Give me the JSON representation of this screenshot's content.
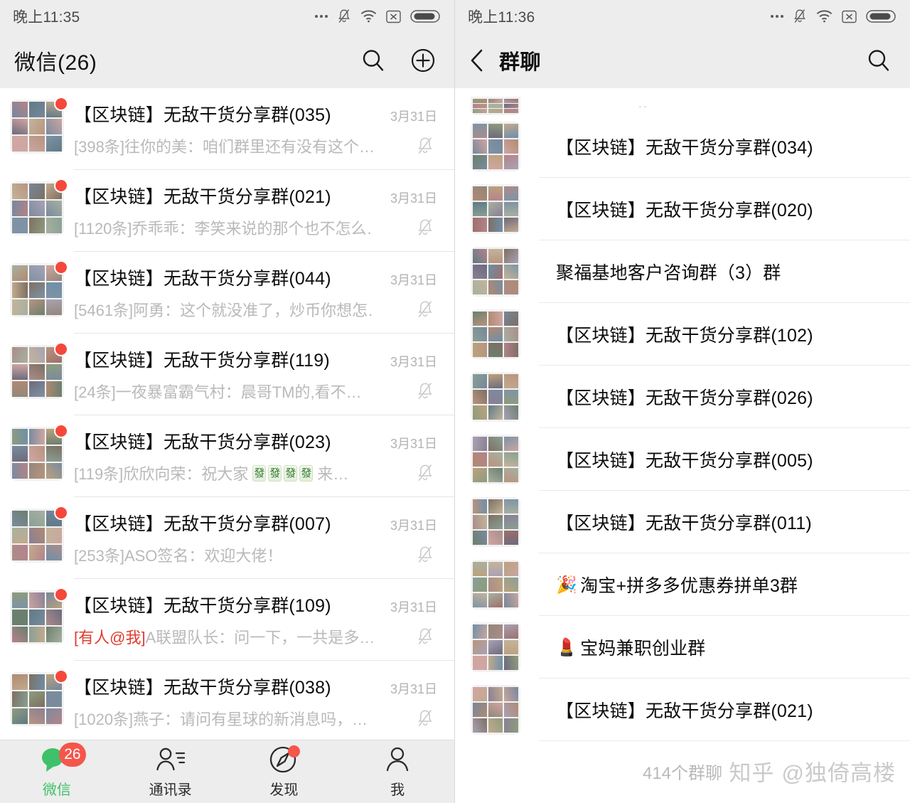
{
  "colors": {
    "accent_green": "#3ec16a",
    "badge_red": "#f5564a",
    "at_me_red": "#e03c30",
    "bar_bg": "#ededed",
    "muted_text": "#b9b9b9"
  },
  "left_panel": {
    "status_bar": {
      "time": "晚上11:35",
      "icons": [
        "more-dots-icon",
        "bell-muted-icon",
        "wifi-icon",
        "no-sim-icon",
        "battery-icon"
      ]
    },
    "nav": {
      "title": "微信(26)",
      "search_icon": "search-icon",
      "add_icon": "plus-circle-icon"
    },
    "chats": [
      {
        "title": "【区块链】无敌干货分享群(035)",
        "time": "3月31日",
        "snippet_prefix": "[398条]",
        "snippet": "往你的美：咱们群里还有没有这个…",
        "at_me": false,
        "muted": true,
        "unread_dot": true
      },
      {
        "title": "【区块链】无敌干货分享群(021)",
        "time": "3月31日",
        "snippet_prefix": "[1120条]",
        "snippet": "乔乖乖：李笑来说的那个也不怎么…",
        "at_me": false,
        "muted": true,
        "unread_dot": true
      },
      {
        "title": "【区块链】无敌干货分享群(044)",
        "time": "3月31日",
        "snippet_prefix": "[5461条]",
        "snippet": "阿勇：这个就没准了，炒币你想怎…",
        "at_me": false,
        "muted": true,
        "unread_dot": true
      },
      {
        "title": "【区块链】无敌干货分享群(119)",
        "time": "3月31日",
        "snippet_prefix": "[24条]",
        "snippet": "一夜暴富霸气村：晨哥TM的,看不…",
        "at_me": false,
        "muted": true,
        "unread_dot": true
      },
      {
        "title": "【区块链】无敌干货分享群(023)",
        "time": "3月31日",
        "snippet_prefix": "[119条]",
        "snippet": "欣欣向荣：祝大家",
        "snippet_tail": "来…",
        "mahjong_tiles": [
          "發",
          "發",
          "發",
          "發"
        ],
        "at_me": false,
        "muted": true,
        "unread_dot": true
      },
      {
        "title": "【区块链】无敌干货分享群(007)",
        "time": "3月31日",
        "snippet_prefix": "[253条]",
        "snippet": "ASO签名：欢迎大佬！",
        "at_me": false,
        "muted": true,
        "unread_dot": true
      },
      {
        "title": "【区块链】无敌干货分享群(109)",
        "time": "3月31日",
        "snippet_prefix": "[有人@我]",
        "snippet": "A联盟队长：问一下，一共是多…",
        "at_me": true,
        "muted": true,
        "unread_dot": true
      },
      {
        "title": "【区块链】无敌干货分享群(038)",
        "time": "3月31日",
        "snippet_prefix": "[1020条]",
        "snippet": "燕子：请问有星球的新消息吗，…",
        "at_me": false,
        "muted": true,
        "unread_dot": true
      }
    ],
    "tabs": [
      {
        "label": "微信",
        "icon": "chat-bubble-icon",
        "active": true,
        "badge_count": "26",
        "dot": false
      },
      {
        "label": "通讯录",
        "icon": "contacts-icon",
        "active": false,
        "badge_count": "",
        "dot": false
      },
      {
        "label": "发现",
        "icon": "compass-icon",
        "active": false,
        "badge_count": "",
        "dot": true
      },
      {
        "label": "我",
        "icon": "person-icon",
        "active": false,
        "badge_count": "",
        "dot": false
      }
    ]
  },
  "right_panel": {
    "status_bar": {
      "time": "晚上11:36",
      "icons": [
        "more-dots-icon",
        "bell-muted-icon",
        "wifi-icon",
        "no-sim-icon",
        "battery-icon"
      ]
    },
    "nav": {
      "back_icon": "back-chevron-icon",
      "title": "群聊",
      "search_icon": "search-icon"
    },
    "scroll_hint": "..",
    "groups": [
      {
        "name": "【区块链】无敌干货分享群(034)",
        "emoji": ""
      },
      {
        "name": "【区块链】无敌干货分享群(020)",
        "emoji": ""
      },
      {
        "name": "聚福基地客户咨询群（3）群",
        "emoji": ""
      },
      {
        "name": "【区块链】无敌干货分享群(102)",
        "emoji": ""
      },
      {
        "name": "【区块链】无敌干货分享群(026)",
        "emoji": ""
      },
      {
        "name": "【区块链】无敌干货分享群(005)",
        "emoji": ""
      },
      {
        "name": "【区块链】无敌干货分享群(011)",
        "emoji": ""
      },
      {
        "name": "淘宝+拼多多优惠券拼单3群",
        "emoji": "🎉"
      },
      {
        "name": "宝妈兼职创业群",
        "emoji": "💄"
      },
      {
        "name": "【区块链】无敌干货分享群(021)",
        "emoji": ""
      }
    ],
    "footer_count": "414个群聊",
    "watermark": {
      "site": "知乎",
      "user": "@独倚高楼"
    }
  }
}
